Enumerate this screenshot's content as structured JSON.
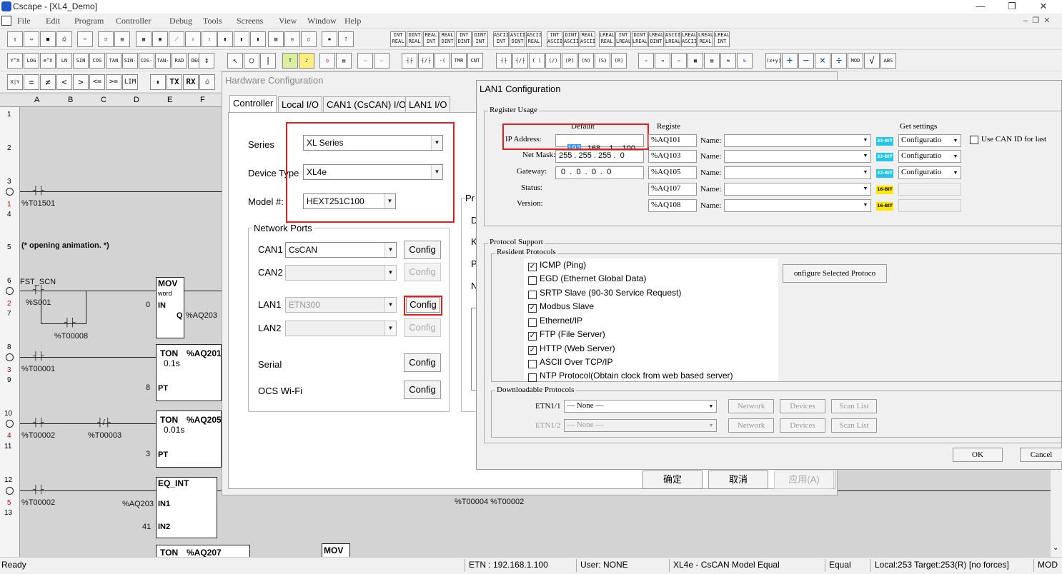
{
  "window": {
    "title": "Cscape - [XL4_Demo]",
    "min": "—",
    "restore": "❐",
    "close": "✕"
  },
  "menu": [
    "File",
    "Edit",
    "Program",
    "Controller",
    "Debug",
    "Tools",
    "Screens",
    "View",
    "Window",
    "Help"
  ],
  "toolbar_row1": [
    "INT REAL",
    "DINT REAL",
    "REAL INT",
    "REAL DINT",
    "INT DINT",
    "DINT INT",
    "ASCII INT",
    "ASCII DINT",
    "ASCII REAL",
    "INT ASCII",
    "DINT ASCII",
    "REAL ASCII",
    "LREAL REAL",
    "INT LREAL",
    "DINT LREAL",
    "LREAL DINT",
    "ASCII LREAL",
    "LREAL ASCII",
    "LREAL REAL",
    "LREAL INT"
  ],
  "toolbar_row2": [
    "Y^X",
    "LOG",
    "e^X",
    "LN",
    "SIN",
    "COS",
    "TAN",
    "SIN-1",
    "COS-1",
    "TAN-1",
    "RAD",
    "DEG",
    "TMR",
    "CNT",
    "MOD",
    "ABS"
  ],
  "toolbar_row3": [
    "X|Y",
    "=",
    "≠",
    "<",
    ">",
    "<=",
    ">=",
    "LIM",
    "TX",
    "RX"
  ],
  "ladder": {
    "columns": [
      "A",
      "B",
      "C",
      "D",
      "E",
      "F"
    ],
    "rows": [
      "1",
      "2",
      "3",
      "4",
      "5",
      "6",
      "7",
      "8",
      "9",
      "10",
      "11",
      "12",
      "13"
    ],
    "rung_numbers": [
      "1",
      "2",
      "3",
      "4",
      "5"
    ],
    "labels": {
      "t01501": "%T01501",
      "comment": "(* opening animation. *)",
      "fst_scn": "FST_SCN",
      "s001": "%S001",
      "t00008": "%T00008",
      "t00001": "%T00001",
      "t00002a": "%T00002",
      "t00003": "%T00003",
      "t00002b": "%T00002",
      "aq203_in": "%AQ203",
      "n0": "0",
      "n8": "8",
      "n3": "3",
      "n41": "41",
      "q_out": "%AQ203",
      "rung_end": "%T00004 %T00002"
    },
    "blocks": {
      "mov": {
        "name": "MOV",
        "sub": "word",
        "in": "IN",
        "q": "Q"
      },
      "ton1": {
        "name": "TON",
        "reg": "%AQ201",
        "time": "0.1s",
        "pt": "PT"
      },
      "ton2": {
        "name": "TON",
        "reg": "%AQ205",
        "time": "0.01s",
        "pt": "PT"
      },
      "eq": {
        "name": "EQ_INT",
        "in1": "IN1",
        "in2": "IN2"
      },
      "ton3": {
        "name": "TON",
        "reg": "%AQ207"
      },
      "mov2": {
        "name": "MOV"
      }
    }
  },
  "hwconfig": {
    "title": "Hardware Configuration",
    "tabs": [
      "Controller",
      "Local I/O",
      "CAN1 (CsCAN) I/O",
      "LAN1 I/O"
    ],
    "series_label": "Series",
    "series_value": "XL Series",
    "device_label": "Device Type",
    "device_value": "XL4e",
    "model_label": "Model #:",
    "model_value": "HEXT251C100",
    "network_ports_title": "Network Ports",
    "ports": [
      {
        "label": "CAN1",
        "value": "CsCAN",
        "button": "Config",
        "enabled": "yes"
      },
      {
        "label": "CAN2",
        "value": "",
        "button": "Config",
        "enabled": "no"
      },
      {
        "label": "LAN1",
        "value": "ETN300",
        "button": "Config",
        "enabled": "yes"
      },
      {
        "label": "LAN2",
        "value": "",
        "button": "Config",
        "enabled": "no"
      }
    ],
    "serial_label": "Serial",
    "serial_button": "Config",
    "wifi_label": "OCS Wi-Fi",
    "wifi_button": "Config",
    "partial_labels": [
      "Pr",
      "D",
      "K",
      "P",
      "N"
    ],
    "ok": "确定",
    "cancel": "取消",
    "apply": "应用(A)"
  },
  "lan1": {
    "title": "LAN1 Configuration",
    "register_usage": "Register Usage",
    "hdr_default": "Default",
    "hdr_register": "Registe",
    "hdr_get": "Get settings",
    "name_label": "Name:",
    "rows": [
      {
        "label": "IP Address:",
        "value": "192 . 168 .  1  . 100",
        "sel": "192",
        "rest": " . 168 .  1  . 100",
        "reg": "%AQ101",
        "bits": "32-BIT",
        "get": "Configuratio"
      },
      {
        "label": "Net Mask:",
        "value": "255 . 255 . 255 .  0",
        "reg": "%AQ103",
        "bits": "32-BIT",
        "get": "Configuratio"
      },
      {
        "label": "Gateway:",
        "value": " 0  .  0  .  0  .  0",
        "reg": "%AQ105",
        "bits": "32-BIT",
        "get": "Configuratio"
      },
      {
        "label": "Status:",
        "value": "",
        "reg": "%AQ107",
        "bits": "16-BIT",
        "get": ""
      },
      {
        "label": "Version:",
        "value": "",
        "reg": "%AQ108",
        "bits": "16-BIT",
        "get": ""
      }
    ],
    "use_can_id": "Use CAN ID for last",
    "protocol_support": "Protocol Support",
    "resident_protocols": "Resident Protocols",
    "protocols": [
      {
        "name": "ICMP (Ping)",
        "checked": "yes"
      },
      {
        "name": "EGD (Ethernet Global Data)",
        "checked": "no"
      },
      {
        "name": "SRTP Slave (90-30 Service Request)",
        "checked": "no"
      },
      {
        "name": "Modbus Slave",
        "checked": "yes"
      },
      {
        "name": "Ethernet/IP",
        "checked": "no"
      },
      {
        "name": "FTP (File Server)",
        "checked": "yes"
      },
      {
        "name": "HTTP (Web Server)",
        "checked": "yes"
      },
      {
        "name": "ASCII Over TCP/IP",
        "checked": "no"
      },
      {
        "name": "NTP Protocol(Obtain clock from web based server)",
        "checked": "no"
      }
    ],
    "configure_selected": "onfigure Selected Protoco",
    "downloadable_protocols": "Downloadable Protocols",
    "etn": [
      {
        "label": "ETN1/1",
        "value": "— None —",
        "enabled": "yes"
      },
      {
        "label": "ETN1/2",
        "value": "— None —",
        "enabled": "no"
      }
    ],
    "network_btn": "Network",
    "devices_btn": "Devices",
    "scanlist_btn": "Scan List",
    "ok": "OK",
    "cancel": "Cancel"
  },
  "status": {
    "ready": "Ready",
    "etn": "ETN : 192.168.1.100",
    "user": "User: NONE",
    "model": "XL4e - CsCAN Model Equal",
    "equal": "Equal",
    "local": "Local:253  Target:253(R) [no forces]",
    "mod": "MOD"
  },
  "colors": {
    "highlight": "#e02020",
    "bit32": "#22c6e6",
    "bit16": "#ffe800",
    "rung_red": "#cc0000"
  }
}
